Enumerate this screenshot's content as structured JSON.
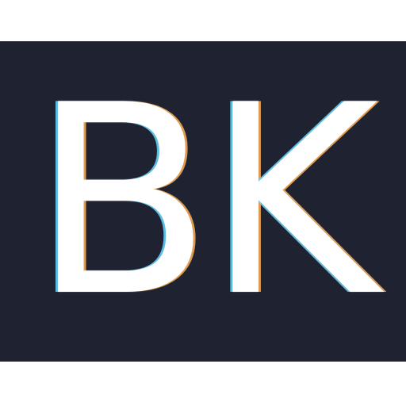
{
  "avatar": {
    "initials": "BK",
    "background_color": "#1f2230",
    "text_color": "#ffffff"
  }
}
